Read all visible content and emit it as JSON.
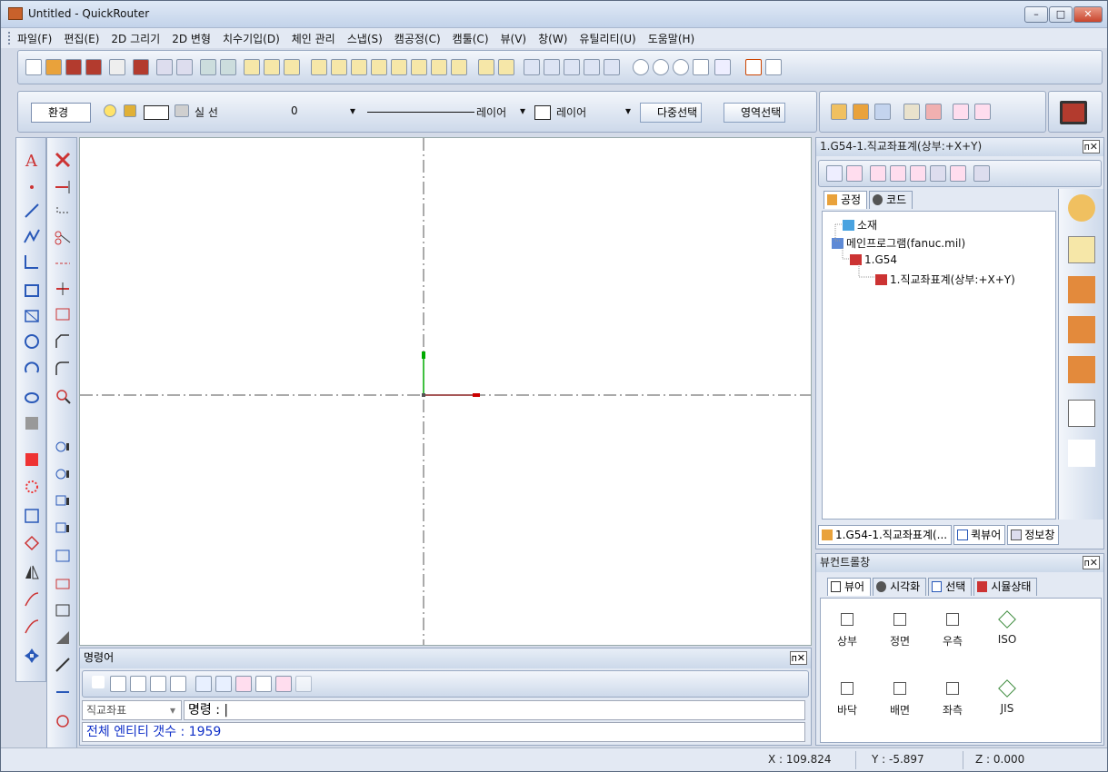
{
  "window": {
    "title": "Untitled - QuickRouter",
    "min": "–",
    "max": "□",
    "close": "✕"
  },
  "menu": [
    "파일(F)",
    "편집(E)",
    "2D 그리기",
    "2D 변형",
    "치수기입(D)",
    "체인 관리",
    "스냅(S)",
    "캠공정(C)",
    "캠툴(C)",
    "뷰(V)",
    "창(W)",
    "유틸리티(U)",
    "도움말(H)"
  ],
  "toolbar2": {
    "env_label": "환경",
    "linetype_label": "실 선",
    "line_width": "0",
    "layer_label_1": "레이어",
    "layer_label_2": "레이어",
    "multi_select": "다중선택",
    "area_select": "영역선택"
  },
  "command": {
    "panel_title": "명령어",
    "coord_combo": "직교좌표",
    "prompt": "명령 : |",
    "history": "전체 엔티티 갯수 : 1959"
  },
  "status": {
    "x": "X : 109.824",
    "y": "Y : -5.897",
    "z": "Z : 0.000"
  },
  "process_panel": {
    "title": "1.G54-1.직교좌표계(상부:+X+Y)",
    "tabs": [
      "공정",
      "코드"
    ],
    "tree": [
      "소재",
      "메인프로그램(fanuc.mil)",
      "1.G54",
      "1.직교좌표계(상부:+X+Y)"
    ],
    "bottom_tabs": [
      "1.G54-1.직교좌표계(...",
      "퀵뷰어",
      "정보창"
    ]
  },
  "view_control": {
    "title": "뷰컨트롤창",
    "tabs": [
      "뷰어",
      "시각화",
      "선택",
      "시뮬상태"
    ],
    "views_row1": [
      "상부",
      "정면",
      "우측",
      "ISO"
    ],
    "views_row2": [
      "바닥",
      "배면",
      "좌측",
      "JIS"
    ]
  },
  "colors": {
    "axis_x": "#cc0000",
    "axis_y": "#00aa00",
    "crosshair": "#555555",
    "history_text": "#1030c8"
  }
}
